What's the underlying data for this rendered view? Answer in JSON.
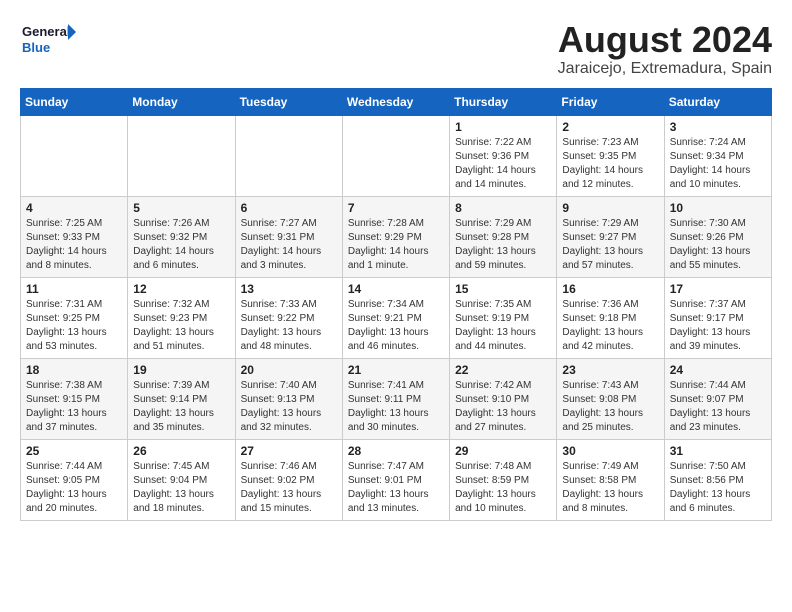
{
  "logo": {
    "line1": "General",
    "line2": "Blue"
  },
  "title": {
    "month_year": "August 2024",
    "location": "Jaraicejo, Extremadura, Spain"
  },
  "weekdays": [
    "Sunday",
    "Monday",
    "Tuesday",
    "Wednesday",
    "Thursday",
    "Friday",
    "Saturday"
  ],
  "weeks": [
    [
      {
        "day": "",
        "info": ""
      },
      {
        "day": "",
        "info": ""
      },
      {
        "day": "",
        "info": ""
      },
      {
        "day": "",
        "info": ""
      },
      {
        "day": "1",
        "info": "Sunrise: 7:22 AM\nSunset: 9:36 PM\nDaylight: 14 hours\nand 14 minutes."
      },
      {
        "day": "2",
        "info": "Sunrise: 7:23 AM\nSunset: 9:35 PM\nDaylight: 14 hours\nand 12 minutes."
      },
      {
        "day": "3",
        "info": "Sunrise: 7:24 AM\nSunset: 9:34 PM\nDaylight: 14 hours\nand 10 minutes."
      }
    ],
    [
      {
        "day": "4",
        "info": "Sunrise: 7:25 AM\nSunset: 9:33 PM\nDaylight: 14 hours\nand 8 minutes."
      },
      {
        "day": "5",
        "info": "Sunrise: 7:26 AM\nSunset: 9:32 PM\nDaylight: 14 hours\nand 6 minutes."
      },
      {
        "day": "6",
        "info": "Sunrise: 7:27 AM\nSunset: 9:31 PM\nDaylight: 14 hours\nand 3 minutes."
      },
      {
        "day": "7",
        "info": "Sunrise: 7:28 AM\nSunset: 9:29 PM\nDaylight: 14 hours\nand 1 minute."
      },
      {
        "day": "8",
        "info": "Sunrise: 7:29 AM\nSunset: 9:28 PM\nDaylight: 13 hours\nand 59 minutes."
      },
      {
        "day": "9",
        "info": "Sunrise: 7:29 AM\nSunset: 9:27 PM\nDaylight: 13 hours\nand 57 minutes."
      },
      {
        "day": "10",
        "info": "Sunrise: 7:30 AM\nSunset: 9:26 PM\nDaylight: 13 hours\nand 55 minutes."
      }
    ],
    [
      {
        "day": "11",
        "info": "Sunrise: 7:31 AM\nSunset: 9:25 PM\nDaylight: 13 hours\nand 53 minutes."
      },
      {
        "day": "12",
        "info": "Sunrise: 7:32 AM\nSunset: 9:23 PM\nDaylight: 13 hours\nand 51 minutes."
      },
      {
        "day": "13",
        "info": "Sunrise: 7:33 AM\nSunset: 9:22 PM\nDaylight: 13 hours\nand 48 minutes."
      },
      {
        "day": "14",
        "info": "Sunrise: 7:34 AM\nSunset: 9:21 PM\nDaylight: 13 hours\nand 46 minutes."
      },
      {
        "day": "15",
        "info": "Sunrise: 7:35 AM\nSunset: 9:19 PM\nDaylight: 13 hours\nand 44 minutes."
      },
      {
        "day": "16",
        "info": "Sunrise: 7:36 AM\nSunset: 9:18 PM\nDaylight: 13 hours\nand 42 minutes."
      },
      {
        "day": "17",
        "info": "Sunrise: 7:37 AM\nSunset: 9:17 PM\nDaylight: 13 hours\nand 39 minutes."
      }
    ],
    [
      {
        "day": "18",
        "info": "Sunrise: 7:38 AM\nSunset: 9:15 PM\nDaylight: 13 hours\nand 37 minutes."
      },
      {
        "day": "19",
        "info": "Sunrise: 7:39 AM\nSunset: 9:14 PM\nDaylight: 13 hours\nand 35 minutes."
      },
      {
        "day": "20",
        "info": "Sunrise: 7:40 AM\nSunset: 9:13 PM\nDaylight: 13 hours\nand 32 minutes."
      },
      {
        "day": "21",
        "info": "Sunrise: 7:41 AM\nSunset: 9:11 PM\nDaylight: 13 hours\nand 30 minutes."
      },
      {
        "day": "22",
        "info": "Sunrise: 7:42 AM\nSunset: 9:10 PM\nDaylight: 13 hours\nand 27 minutes."
      },
      {
        "day": "23",
        "info": "Sunrise: 7:43 AM\nSunset: 9:08 PM\nDaylight: 13 hours\nand 25 minutes."
      },
      {
        "day": "24",
        "info": "Sunrise: 7:44 AM\nSunset: 9:07 PM\nDaylight: 13 hours\nand 23 minutes."
      }
    ],
    [
      {
        "day": "25",
        "info": "Sunrise: 7:44 AM\nSunset: 9:05 PM\nDaylight: 13 hours\nand 20 minutes."
      },
      {
        "day": "26",
        "info": "Sunrise: 7:45 AM\nSunset: 9:04 PM\nDaylight: 13 hours\nand 18 minutes."
      },
      {
        "day": "27",
        "info": "Sunrise: 7:46 AM\nSunset: 9:02 PM\nDaylight: 13 hours\nand 15 minutes."
      },
      {
        "day": "28",
        "info": "Sunrise: 7:47 AM\nSunset: 9:01 PM\nDaylight: 13 hours\nand 13 minutes."
      },
      {
        "day": "29",
        "info": "Sunrise: 7:48 AM\nSunset: 8:59 PM\nDaylight: 13 hours\nand 10 minutes."
      },
      {
        "day": "30",
        "info": "Sunrise: 7:49 AM\nSunset: 8:58 PM\nDaylight: 13 hours\nand 8 minutes."
      },
      {
        "day": "31",
        "info": "Sunrise: 7:50 AM\nSunset: 8:56 PM\nDaylight: 13 hours\nand 6 minutes."
      }
    ]
  ]
}
